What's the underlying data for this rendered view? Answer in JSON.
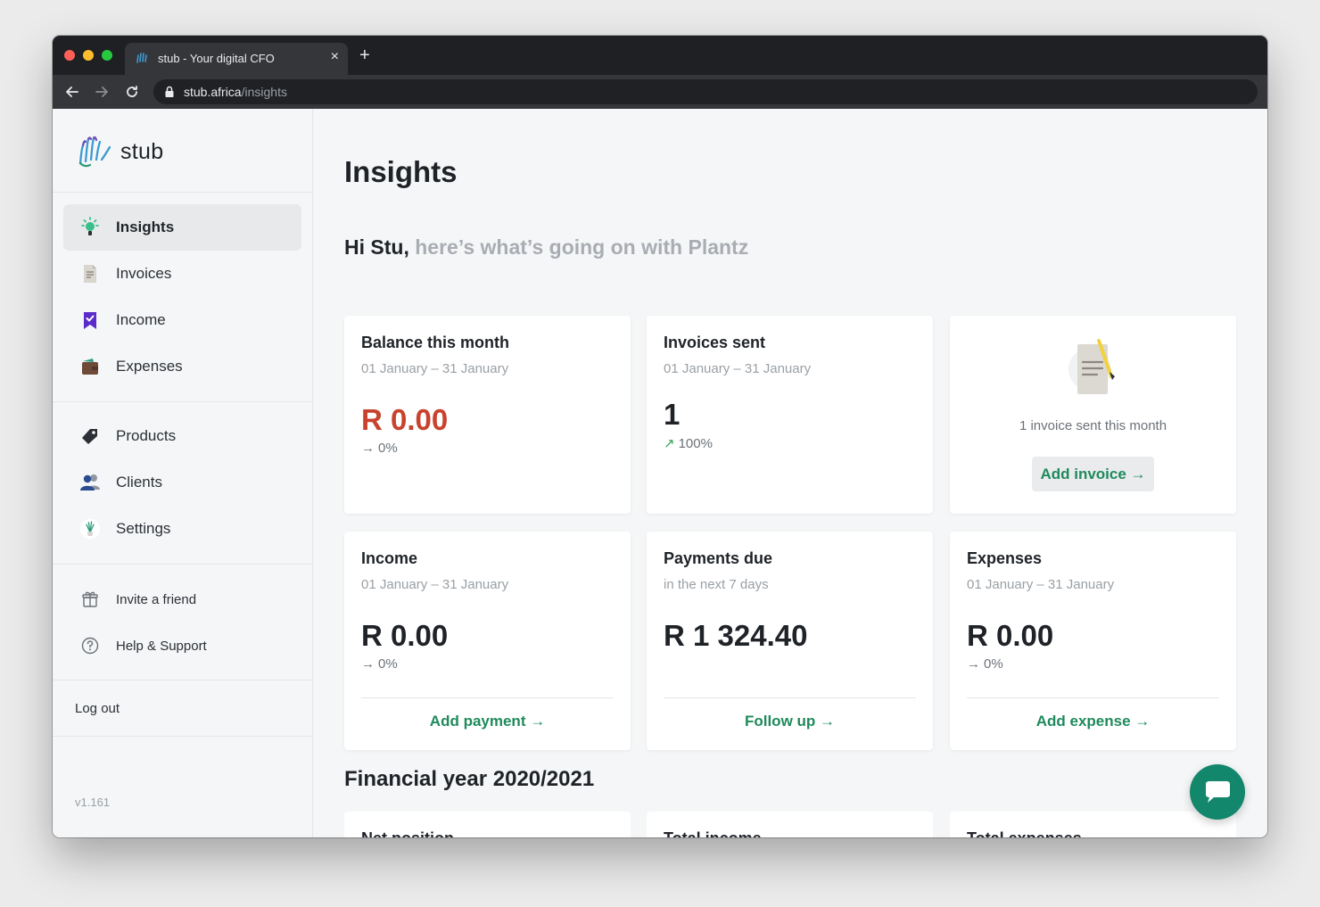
{
  "browser": {
    "tab_title": "stub - Your digital CFO",
    "tab_close": "×",
    "new_tab": "+",
    "url_domain": "stub.africa",
    "url_path": "/insights"
  },
  "sidebar": {
    "logo_text": "stub",
    "nav_primary": [
      {
        "label": "Insights",
        "icon": "lightbulb-icon",
        "active": true
      },
      {
        "label": "Invoices",
        "icon": "document-icon"
      },
      {
        "label": "Income",
        "icon": "checked-bookmark-icon"
      },
      {
        "label": "Expenses",
        "icon": "wallet-icon"
      }
    ],
    "nav_secondary": [
      {
        "label": "Products",
        "icon": "tag-icon"
      },
      {
        "label": "Clients",
        "icon": "people-icon"
      },
      {
        "label": "Settings",
        "icon": "plant-icon"
      }
    ],
    "nav_tertiary": [
      {
        "label": "Invite a friend",
        "icon": "gift-icon"
      },
      {
        "label": "Help & Support",
        "icon": "question-circle-icon"
      }
    ],
    "logout": "Log out",
    "version": "v1.161"
  },
  "main": {
    "title": "Insights",
    "greeting_name": "Hi Stu,",
    "greeting_rest": "here’s what’s going on with Plantz",
    "cards": {
      "balance": {
        "title": "Balance this month",
        "subtitle": "01 January – 31 January",
        "value": "R 0.00",
        "change": "0%",
        "value_color": "#c8422c"
      },
      "invoices_sent": {
        "title": "Invoices sent",
        "subtitle": "01 January – 31 January",
        "value": "1",
        "change": "100%"
      },
      "invoice_notice": {
        "text": "1 invoice sent this month",
        "button": "Add invoice →"
      },
      "income": {
        "title": "Income",
        "subtitle": "01 January – 31 January",
        "value": "R 0.00",
        "change": "0%",
        "link": "Add payment →"
      },
      "payments_due": {
        "title": "Payments due",
        "subtitle": "in the next 7 days",
        "value": "R 1 324.40",
        "link": "Follow up →"
      },
      "expenses": {
        "title": "Expenses",
        "subtitle": "01 January – 31 January",
        "value": "R 0.00",
        "change": "0%",
        "link": "Add expense →"
      }
    },
    "financial_year_title": "Financial year 2020/2021",
    "fy_cards": [
      "Net position",
      "Total income",
      "Total expenses"
    ]
  },
  "colors": {
    "accent_green": "#1f8a5c",
    "negative_red": "#c8422c",
    "chat_fab": "#13876b"
  }
}
